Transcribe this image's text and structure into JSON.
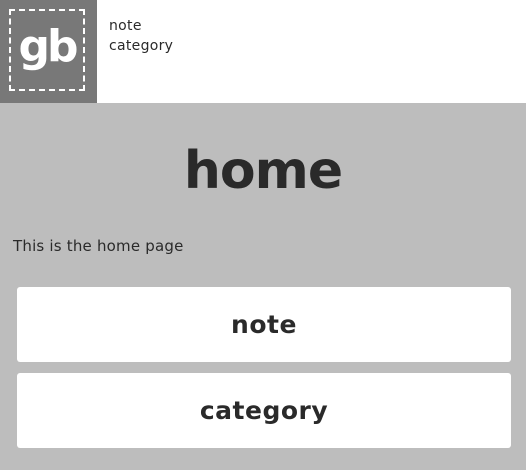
{
  "header": {
    "logo_text": "gb",
    "nav": [
      {
        "label": "note"
      },
      {
        "label": "category"
      }
    ]
  },
  "main": {
    "title": "home",
    "intro": "This is the home page",
    "cards": [
      {
        "label": "note"
      },
      {
        "label": "category"
      }
    ]
  },
  "colors": {
    "page_background": "#bdbdbd",
    "header_background": "#ffffff",
    "logo_background": "#787878",
    "card_background": "#ffffff",
    "text": "#2a2a2a"
  }
}
